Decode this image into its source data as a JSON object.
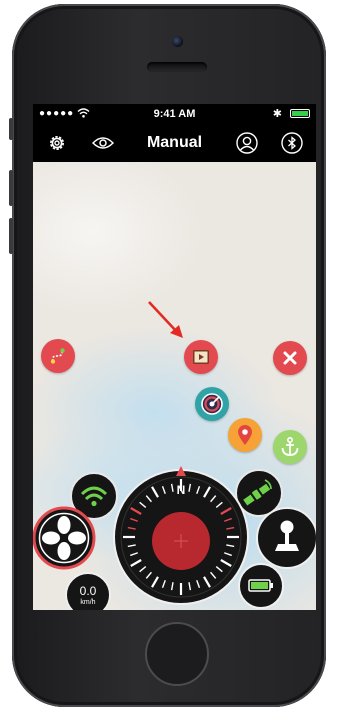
{
  "status_bar": {
    "signal": "●●●●● ",
    "time": "9:41 AM",
    "bluetooth": "✱"
  },
  "nav": {
    "title": "Manual",
    "icons": [
      "gear-icon",
      "eye-icon",
      "user-icon",
      "bluetooth-icon"
    ]
  },
  "speed": {
    "value": "0.0",
    "unit": "km/h"
  },
  "compass": {
    "north_label": "N"
  },
  "colors": {
    "accent_red": "#e24a4f",
    "green": "#6fd04a",
    "teal": "#2fa3a6",
    "orange": "#f6a237",
    "anchor_green": "#9dd66c",
    "dark": "#151515"
  },
  "map_buttons": [
    "route-icon",
    "play-icon",
    "close-icon",
    "target-icon",
    "location-pin-icon",
    "anchor-icon"
  ],
  "dash_icons": [
    "wifi-icon",
    "satellite-icon",
    "fan-icon",
    "joystick-icon",
    "battery-icon"
  ]
}
